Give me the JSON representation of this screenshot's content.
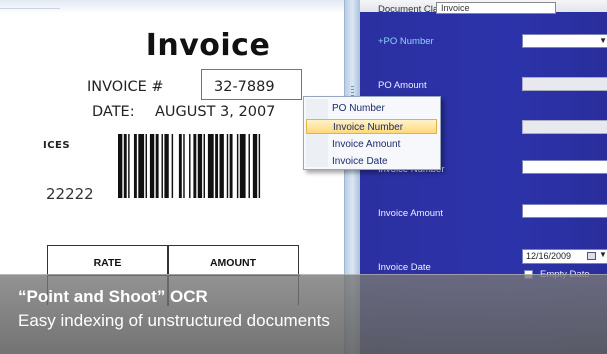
{
  "document": {
    "title": "Invoice",
    "invoice_number_label": "INVOICE #",
    "invoice_number_value": "32-7889",
    "date_label": "DATE:",
    "date_value": "AUGUST 3, 2007",
    "section_fragment": "ICES",
    "zip_code": "22222",
    "table_headers": [
      "RATE",
      "AMOUNT"
    ]
  },
  "form": {
    "document_class_label": "Document Class:",
    "document_class_value": "Invoice",
    "fields": {
      "po_number": "+PO Number",
      "po_amount": "PO Amount",
      "invoice_number": "Invoice Number",
      "invoice_amount": "Invoice Amount",
      "invoice_date": "Invoice Date"
    },
    "date_value": "12/16/2009",
    "empty_date_label": "Empty Date"
  },
  "context_menu": {
    "items": [
      "PO Number",
      "Invoice Number",
      "Invoice Amount",
      "Invoice Date"
    ],
    "selected_index": 1
  },
  "caption": {
    "title": "“Point and Shoot” OCR",
    "subtitle": "Easy indexing of unstructured documents"
  },
  "colors": {
    "form_background": "#2c33aa",
    "highlight_box": "#d84a4a",
    "menu_selection": "#ffd97a",
    "required_field_label": "#8fd3ff"
  },
  "icons": [
    "barcode-icon",
    "calendar-icon",
    "dropdown-arrow-icon",
    "splitter-grip-icon"
  ]
}
